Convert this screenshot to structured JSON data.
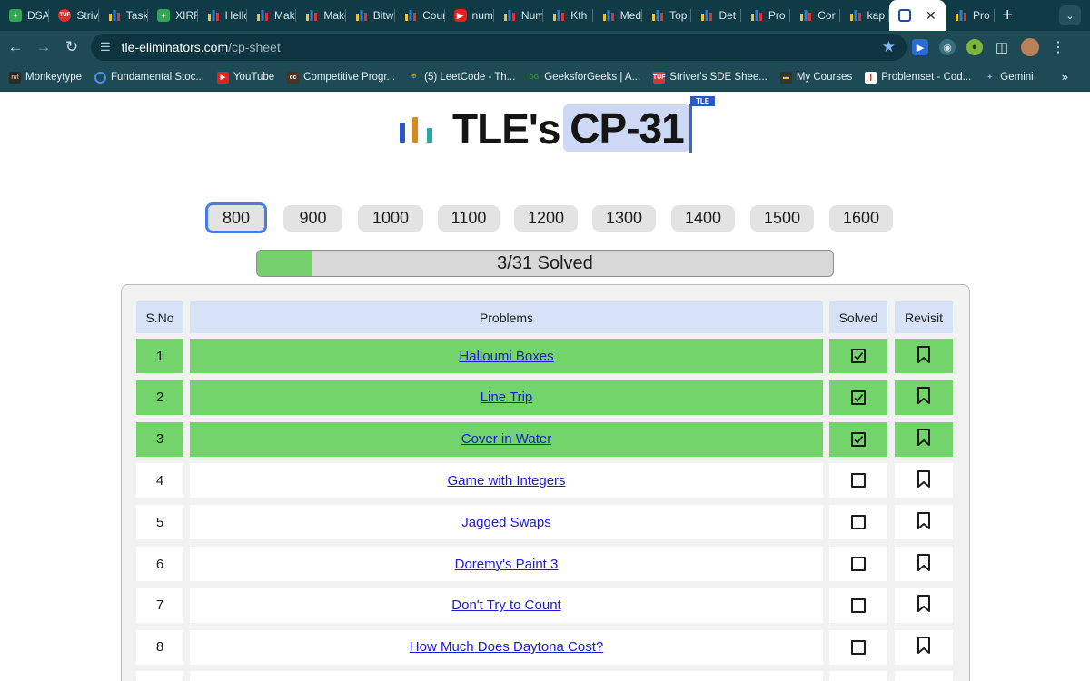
{
  "browser": {
    "tabs": [
      {
        "label": "DSA",
        "icon": "sheets-icon"
      },
      {
        "label": "Striver",
        "icon": "tuf-icon"
      },
      {
        "label": "Task",
        "icon": "codeforces-icon"
      },
      {
        "label": "XIRR",
        "icon": "sheets-icon"
      },
      {
        "label": "Hello",
        "icon": "codeforces-icon"
      },
      {
        "label": "Make",
        "icon": "codeforces-icon"
      },
      {
        "label": "Make",
        "icon": "codeforces-icon"
      },
      {
        "label": "Bitwise",
        "icon": "codeforces-icon"
      },
      {
        "label": "Count",
        "icon": "codeforces-icon"
      },
      {
        "label": "number",
        "icon": "youtube-icon"
      },
      {
        "label": "Number",
        "icon": "codeforces-icon"
      },
      {
        "label": "Kth",
        "icon": "codeforces-icon"
      },
      {
        "label": "Medium",
        "icon": "codeforces-icon"
      },
      {
        "label": "Top",
        "icon": "codeforces-icon"
      },
      {
        "label": "Det",
        "icon": "codeforces-icon"
      },
      {
        "label": "Pro",
        "icon": "codeforces-icon"
      },
      {
        "label": "Cor",
        "icon": "codeforces-icon"
      },
      {
        "label": "kap",
        "icon": "codeforces-icon"
      },
      {
        "label": "",
        "icon": "tle-icon",
        "active": true
      },
      {
        "label": "Pro",
        "icon": "codeforces-icon"
      }
    ],
    "url_domain": "tle-eliminators.com",
    "url_path": "/cp-sheet",
    "bookmarks": [
      {
        "label": "Monkeytype",
        "icon": "mt"
      },
      {
        "label": "Fundamental Stoc...",
        "icon": "circle"
      },
      {
        "label": "YouTube",
        "icon": "yt"
      },
      {
        "label": "Competitive Progr...",
        "icon": "cc"
      },
      {
        "label": "(5) LeetCode - Th...",
        "icon": "lc"
      },
      {
        "label": "GeeksforGeeks | A...",
        "icon": "gfg"
      },
      {
        "label": "Striver's SDE Shee...",
        "icon": "tuf"
      },
      {
        "label": "My Courses",
        "icon": "course"
      },
      {
        "label": "Problemset - Cod...",
        "icon": "cf"
      },
      {
        "label": "Gemini",
        "icon": "gemini"
      }
    ]
  },
  "brand": {
    "name": "TLE's",
    "badge": "CP-31",
    "flag": "TLE",
    "bar_colors": [
      "#2a59c4",
      "#d98a1f",
      "#2aa7a7"
    ]
  },
  "ratings": {
    "items": [
      "800",
      "900",
      "1000",
      "1100",
      "1200",
      "1300",
      "1400",
      "1500",
      "1600"
    ],
    "selected": "800"
  },
  "progress": {
    "label": "3/31 Solved",
    "solved": 3,
    "total": 31,
    "fill_color": "#75d16c"
  },
  "table": {
    "headers": {
      "sno": "S.No",
      "problems": "Problems",
      "solved": "Solved",
      "revisit": "Revisit"
    },
    "rows": [
      {
        "sno": "1",
        "problem": "Halloumi Boxes",
        "solved": true
      },
      {
        "sno": "2",
        "problem": "Line Trip",
        "solved": true
      },
      {
        "sno": "3",
        "problem": "Cover in Water",
        "solved": true
      },
      {
        "sno": "4",
        "problem": "Game with Integers",
        "solved": false
      },
      {
        "sno": "5",
        "problem": "Jagged Swaps",
        "solved": false
      },
      {
        "sno": "6",
        "problem": "Doremy's Paint 3",
        "solved": false
      },
      {
        "sno": "7",
        "problem": "Don't Try to Count",
        "solved": false
      },
      {
        "sno": "8",
        "problem": "How Much Does Daytona Cost?",
        "solved": false
      },
      {
        "sno": "",
        "problem": "",
        "solved": false
      }
    ],
    "solved_color": "#72d46a"
  }
}
